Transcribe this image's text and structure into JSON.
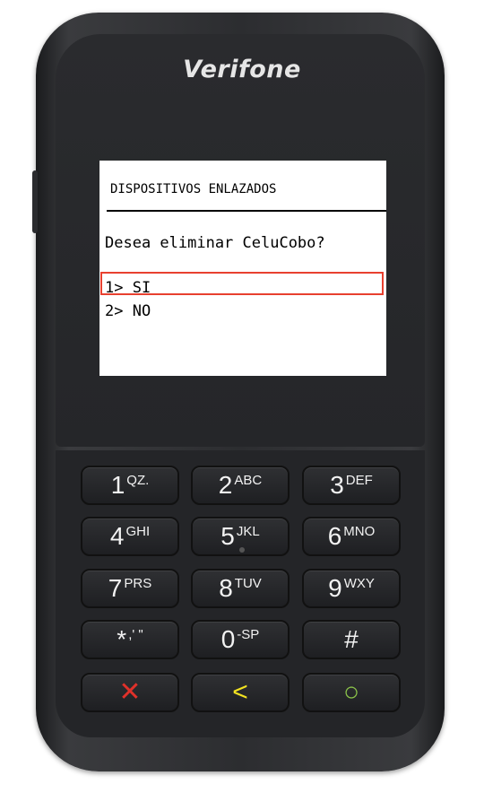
{
  "device": {
    "brand": "Verifone"
  },
  "screen": {
    "title": "DISPOSITIVOS ENLAZADOS",
    "question": "Desea eliminar CeluCobo?",
    "options": [
      {
        "label": "1> SI",
        "highlighted": true
      },
      {
        "label": "2> NO",
        "highlighted": false
      }
    ],
    "highlight_color": "#e8402f"
  },
  "keypad": {
    "rows": [
      [
        {
          "num": "1",
          "sub": "QZ."
        },
        {
          "num": "2",
          "sub": "ABC"
        },
        {
          "num": "3",
          "sub": "DEF"
        }
      ],
      [
        {
          "num": "4",
          "sub": "GHI"
        },
        {
          "num": "5",
          "sub": "JKL"
        },
        {
          "num": "6",
          "sub": "MNO"
        }
      ],
      [
        {
          "num": "7",
          "sub": "PRS"
        },
        {
          "num": "8",
          "sub": "TUV"
        },
        {
          "num": "9",
          "sub": "WXY"
        }
      ],
      [
        {
          "num": "*",
          "sub": ",' \""
        },
        {
          "num": "0",
          "sub": "-SP"
        },
        {
          "num": "#",
          "sub": ""
        }
      ],
      [
        {
          "sym": "✕",
          "icon": "cancel-x-icon",
          "color": "#e0312a"
        },
        {
          "sym": "<",
          "icon": "back-arrow-icon",
          "color": "#f3e321"
        },
        {
          "sym": "○",
          "icon": "enter-circle-icon",
          "color": "#8bc34a"
        }
      ]
    ]
  }
}
